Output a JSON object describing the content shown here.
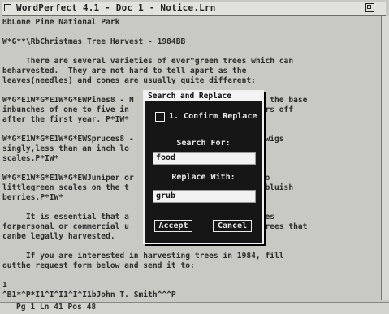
{
  "window": {
    "title": "WordPerfect 4.1 - Doc 1 - Notice.Lrn"
  },
  "document": {
    "lines": [
      "BbLone Pine National Park",
      "",
      "W*G**\\RbChristmas Tree Harvest - 1984BB",
      "",
      "     There are several varieties of ever\"green trees which can",
      "beharvested.  They are not hard to tell apart as the",
      "leaves(needles) and cones are usually quite different:",
      "",
      "W*G*E1W*G*E1W*G*EWPines8 - N                          at the base",
      "inbunches of one to five in                          wears off",
      "after the first year. P*IW*",
      "",
      "W*G*E1W*G*E1W*G*EWSpruces8 -                        he twigs",
      "singly,less than an inch lo                          y",
      "scales.P*IW*",
      "",
      "W*G*E1W*G*E1W*G*EWJuniper or                         d to",
      "littlegreen scales on the t                          it bluish",
      "berries.P*IW*",
      "",
      "     It is essential that a                          trees",
      "forpersonal or commercial u                          e trees that",
      "canbe legally harvested.",
      "",
      "     If you are interested in harvesting trees in 1984, fill",
      "outthe request form below and send it to:",
      "",
      "1",
      "^B1*^P*I1^I^I1^I^I1bJohn T. Smith^^^P"
    ]
  },
  "status_bar": {
    "text": "Pg 1 Ln 41 Pos 48"
  },
  "dialog": {
    "title": "Search and Replace",
    "confirm_label": "1. Confirm Replace",
    "search_label": "Search For:",
    "search_value": "food",
    "replace_label": "Replace With:",
    "replace_value": "grub",
    "accept_label": "Accept",
    "cancel_label": "Cancel"
  },
  "icons": {
    "close": "close-box-icon",
    "size": "size-box-icon"
  }
}
